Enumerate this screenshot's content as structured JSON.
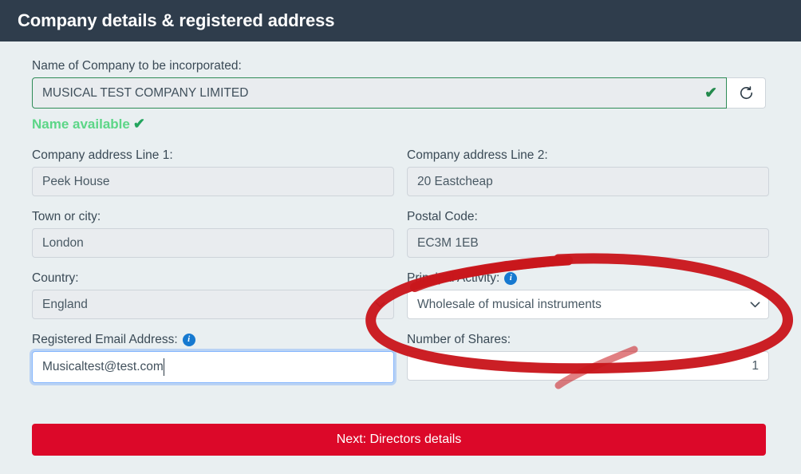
{
  "header": {
    "title": "Company details & registered address"
  },
  "form": {
    "company_name": {
      "label": "Name of Company to be incorporated:",
      "value": "MUSICAL TEST COMPANY LIMITED",
      "valid_tick": "✔",
      "refresh_icon": "refresh-icon",
      "availability_text": "Name available",
      "availability_tick": "✔"
    },
    "address_line_1": {
      "label": "Company address Line 1:",
      "value": "Peek House"
    },
    "address_line_2": {
      "label": "Company address Line 2:",
      "value": "20 Eastcheap"
    },
    "town_or_city": {
      "label": "Town or city:",
      "value": "London"
    },
    "postal_code": {
      "label": "Postal Code:",
      "value": "EC3M 1EB"
    },
    "country": {
      "label": "Country:",
      "value": "England",
      "chevron_icon": "chevron-down-icon"
    },
    "principal_activity": {
      "label": "Principal Activity:",
      "value": "Wholesale of musical instruments",
      "info_icon": "info-icon",
      "info_glyph": "i",
      "chevron_icon": "chevron-down-icon"
    },
    "registered_email": {
      "label": "Registered Email Address:",
      "value": "Musicaltest@test.com",
      "info_icon": "info-icon",
      "info_glyph": "i"
    },
    "number_of_shares": {
      "label": "Number of Shares:",
      "value": "1"
    },
    "next_button": {
      "label": "Next: Directors details"
    }
  },
  "annotation": {
    "type": "hand-drawn-ellipse",
    "color": "#c9161c",
    "target": "principal-activity-field"
  },
  "colors": {
    "header_bg": "#2f3d4c",
    "page_bg": "#e9eff1",
    "primary_button": "#dc0829",
    "valid_green": "#2e8b57",
    "available_green": "#5cd687",
    "info_blue": "#1679d0",
    "focus_blue": "#86b7fe",
    "annotation_red": "#c9161c"
  }
}
